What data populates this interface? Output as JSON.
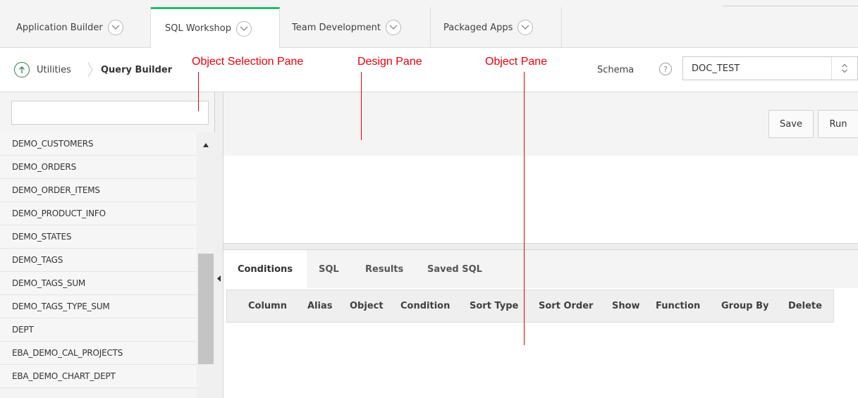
{
  "tabs": [
    {
      "label": "Application Builder"
    },
    {
      "label": "SQL Workshop"
    },
    {
      "label": "Team Development"
    },
    {
      "label": "Packaged Apps"
    }
  ],
  "breadcrumb": {
    "parent": "Utilities",
    "current": "Query Builder"
  },
  "schema": {
    "label": "Schema",
    "help": "?",
    "value": "DOC_TEST"
  },
  "annotations": {
    "object_selection": "Object Selection Pane",
    "design": "Design Pane",
    "object": "Object Pane"
  },
  "search": {
    "value": "",
    "placeholder": ""
  },
  "tables": [
    "DEMO_CUSTOMERS",
    "DEMO_ORDERS",
    "DEMO_ORDER_ITEMS",
    "DEMO_PRODUCT_INFO",
    "DEMO_STATES",
    "DEMO_TAGS",
    "DEMO_TAGS_SUM",
    "DEMO_TAGS_TYPE_SUM",
    "DEPT",
    "EBA_DEMO_CAL_PROJECTS",
    "EBA_DEMO_CHART_DEPT"
  ],
  "toolbar": {
    "save": "Save",
    "run": "Run"
  },
  "bottom_tabs": [
    "Conditions",
    "SQL",
    "Results",
    "Saved SQL"
  ],
  "columns": [
    "Column",
    "Alias",
    "Object",
    "Condition",
    "Sort Type",
    "Sort Order",
    "Show",
    "Function",
    "Group By",
    "Delete"
  ],
  "colors": {
    "accent": "#2bb673",
    "annotation": "#e8000b"
  }
}
